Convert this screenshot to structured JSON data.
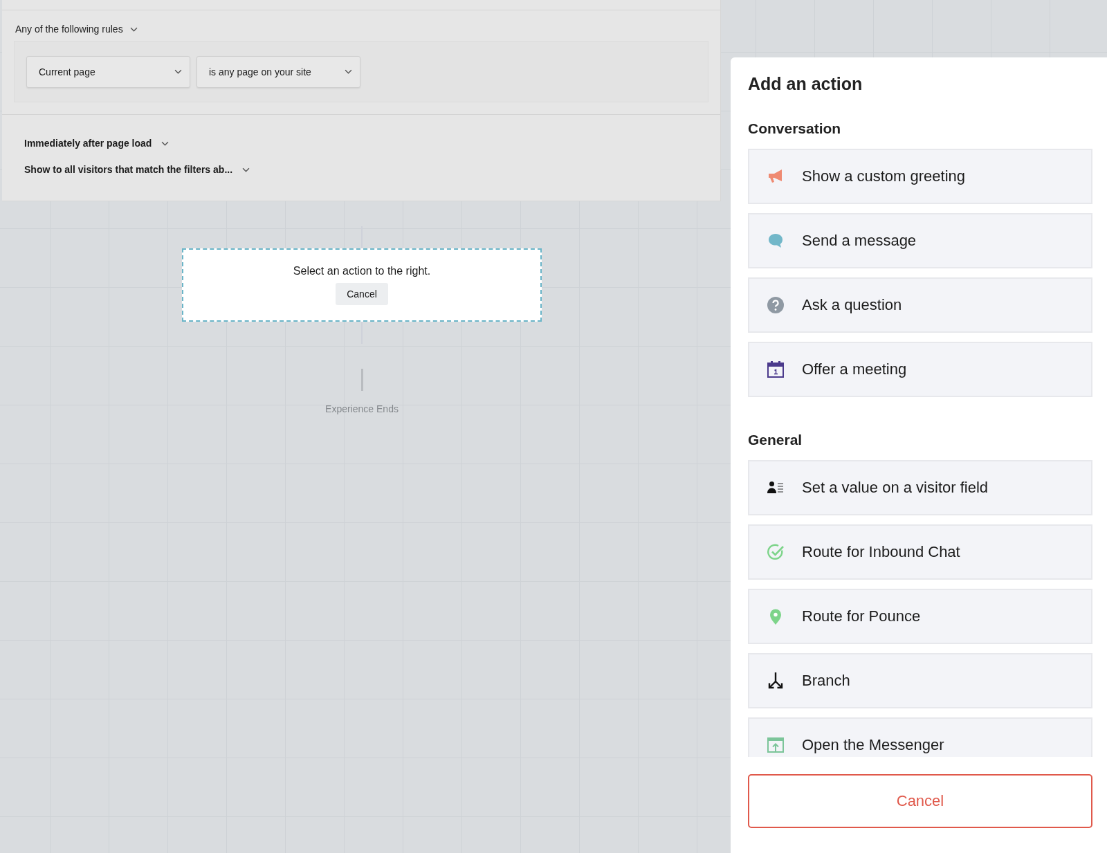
{
  "filters": {
    "rules_label": "Any of the following rules",
    "conditions": [
      {
        "field": "Current page",
        "operator": "is any page on your site"
      }
    ]
  },
  "timing": {
    "label": "Immediately after page load"
  },
  "audience": {
    "label": "Show to all visitors that match the filters ab..."
  },
  "placeholder_card": {
    "message": "Select an action to the right.",
    "cancel": "Cancel"
  },
  "end_label": "Experience Ends",
  "panel": {
    "title": "Add an action",
    "sections": [
      {
        "heading": "Conversation",
        "actions": [
          {
            "kind": "greeting",
            "label": "Show a custom greeting"
          },
          {
            "kind": "message",
            "label": "Send a message"
          },
          {
            "kind": "question",
            "label": "Ask a question"
          },
          {
            "kind": "meeting",
            "label": "Offer a meeting"
          }
        ]
      },
      {
        "heading": "General",
        "actions": [
          {
            "kind": "visitor_field",
            "label": "Set a value on a visitor field"
          },
          {
            "kind": "inbound_chat",
            "label": "Route for Inbound Chat"
          },
          {
            "kind": "pounce",
            "label": "Route for Pounce"
          },
          {
            "kind": "branch",
            "label": "Branch"
          },
          {
            "kind": "messenger",
            "label": "Open the Messenger"
          }
        ]
      }
    ],
    "cancel": "Cancel"
  }
}
